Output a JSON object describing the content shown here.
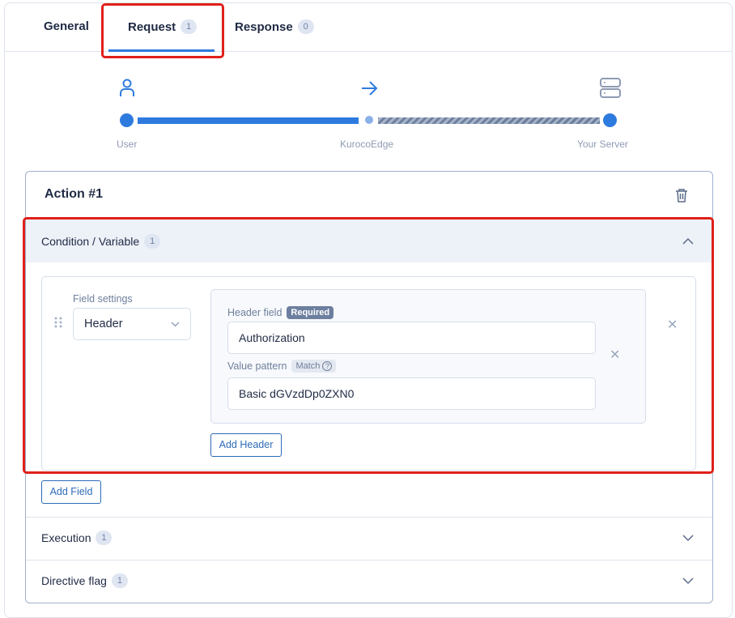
{
  "tabs": [
    {
      "label": "General"
    },
    {
      "label": "Request",
      "badge": "1",
      "active": true
    },
    {
      "label": "Response",
      "badge": "0"
    }
  ],
  "flow": {
    "steps": [
      "User",
      "KurocoEdge",
      "Your Server"
    ]
  },
  "action": {
    "title": "Action #1",
    "condition": {
      "title": "Condition / Variable",
      "badge": "1",
      "field_settings_label": "Field settings",
      "field_type": "Header",
      "header_field_label": "Header field",
      "required_badge": "Required",
      "header_field_value": "Authorization",
      "value_pattern_label": "Value pattern",
      "match_badge": "Match",
      "value_pattern_value": "Basic dGVzdDp0ZXN0",
      "add_header": "Add Header"
    },
    "add_field": "Add Field",
    "execution": {
      "title": "Execution",
      "badge": "1"
    },
    "directive": {
      "title": "Directive flag",
      "badge": "1"
    }
  },
  "colors": {
    "accent": "#2e7be0",
    "highlight": "#e0201a"
  }
}
